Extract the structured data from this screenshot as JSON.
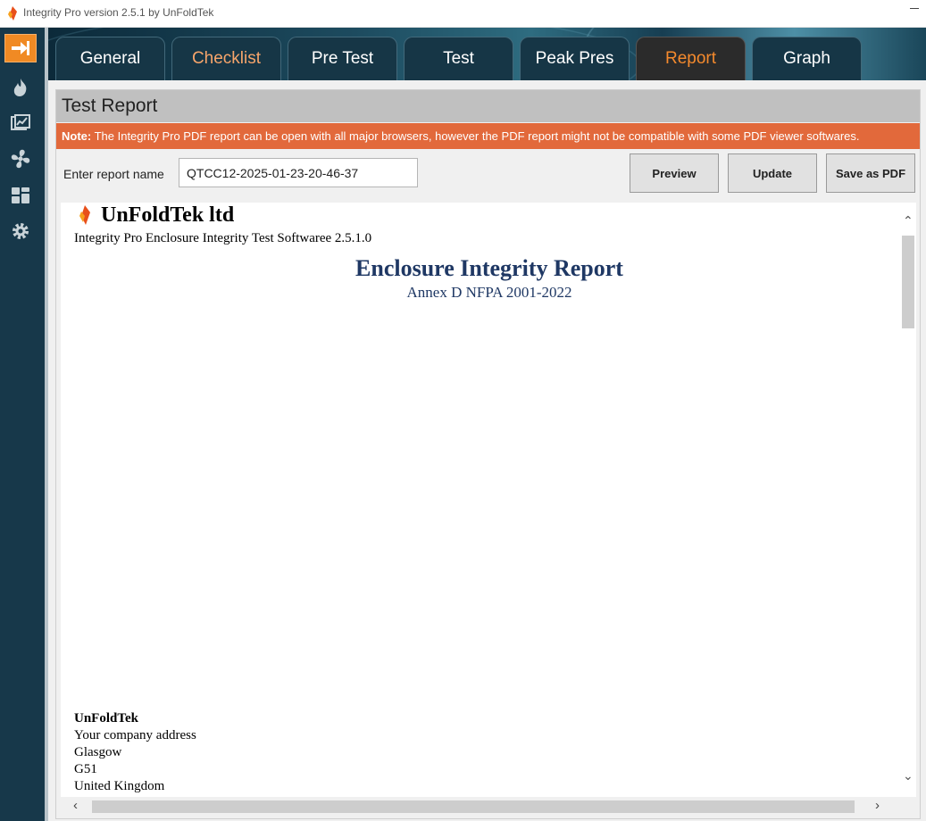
{
  "window": {
    "title": "Integrity Pro version 2.5.1 by UnFoldTek"
  },
  "sidebar": {
    "items": [
      {
        "icon": "arrow-right-icon",
        "active": true
      },
      {
        "icon": "flame-icon",
        "active": false
      },
      {
        "icon": "chart-icon",
        "active": false
      },
      {
        "icon": "fan-icon",
        "active": false
      },
      {
        "icon": "dashboard-icon",
        "active": false
      },
      {
        "icon": "gear-icon",
        "active": false
      }
    ]
  },
  "tabs": [
    {
      "label": "General"
    },
    {
      "label": "Checklist"
    },
    {
      "label": "Pre Test"
    },
    {
      "label": "Test"
    },
    {
      "label": "Peak Pres"
    },
    {
      "label": "Report"
    },
    {
      "label": "Graph"
    }
  ],
  "active_tab": "Report",
  "panel": {
    "title": "Test Report",
    "note_label": "Note:",
    "note_text": " The Integrity Pro PDF report can be open with all major browsers, however the PDF report might not be compatible with some PDF viewer softwares.",
    "report_name_label": "Enter report name",
    "report_name_value": "QTCC12-2025-01-23-20-46-37",
    "buttons": {
      "preview": "Preview",
      "update": "Update",
      "save_pdf": "Save as PDF"
    }
  },
  "report": {
    "company": "UnFoldTek ltd",
    "software": "Integrity Pro Enclosure Integrity Test Softwaree 2.5.1.0",
    "title": "Enclosure Integrity Report",
    "subtitle": "Annex D NFPA 2001-2022",
    "address": {
      "name": "UnFoldTek",
      "line1": "Your company address",
      "city": "Glasgow",
      "postcode": "G51",
      "country": "United Kingdom"
    }
  },
  "colors": {
    "accent": "#f08a24",
    "note_bar": "#e2693b",
    "sidebar": "#17384a",
    "report_title": "#1f3864"
  }
}
